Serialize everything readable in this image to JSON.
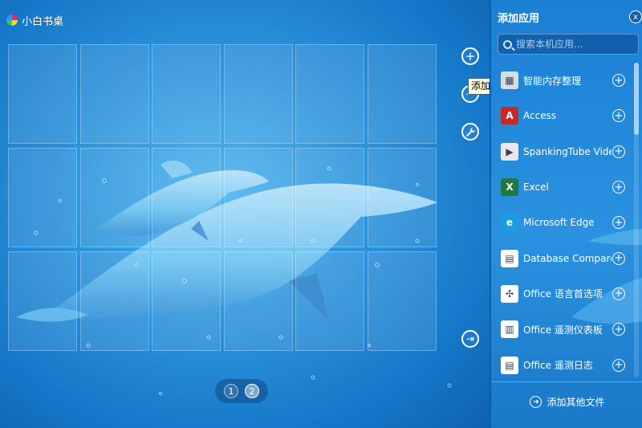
{
  "app": {
    "title": "小白书桌"
  },
  "desk": {
    "grid_rows": 3,
    "grid_cols": 6,
    "tooltip": "添加应用",
    "side_buttons": [
      {
        "name": "add-app-button",
        "icon": "plus-icon"
      },
      {
        "name": "remove-app-button",
        "icon": "minus-icon"
      },
      {
        "name": "settings-button",
        "icon": "wrench-icon"
      },
      {
        "name": "exit-button",
        "icon": "exit-arrow-icon"
      }
    ],
    "pages": [
      "1",
      "2"
    ],
    "active_page": "2"
  },
  "panel": {
    "title": "添加应用",
    "close_label": "x",
    "search_placeholder": "搜索本机应用...",
    "add_label": "+",
    "items": [
      {
        "label": "智能内存整理",
        "icon": "memory-cleaner-icon",
        "color": "#d9dde3"
      },
      {
        "label": "Access",
        "icon": "access-icon",
        "color": "#c32b2b"
      },
      {
        "label": "SpankingTube Video",
        "icon": "video-icon",
        "color": "#e8e8e8"
      },
      {
        "label": "Excel",
        "icon": "excel-icon",
        "color": "#1f7a3f"
      },
      {
        "label": "Microsoft Edge",
        "icon": "edge-icon",
        "color": "#1b9be0"
      },
      {
        "label": "Database Compare",
        "icon": "database-compare-icon",
        "color": "#ffffff"
      },
      {
        "label": "Office 语言首选项",
        "icon": "office-language-icon",
        "color": "#ffffff"
      },
      {
        "label": "Office 遥测仪表板",
        "icon": "telemetry-dashboard-icon",
        "color": "#ffffff"
      },
      {
        "label": "Office 遥测日志",
        "icon": "telemetry-log-icon",
        "color": "#ffffff"
      }
    ],
    "footer_label": "添加其他文件"
  }
}
